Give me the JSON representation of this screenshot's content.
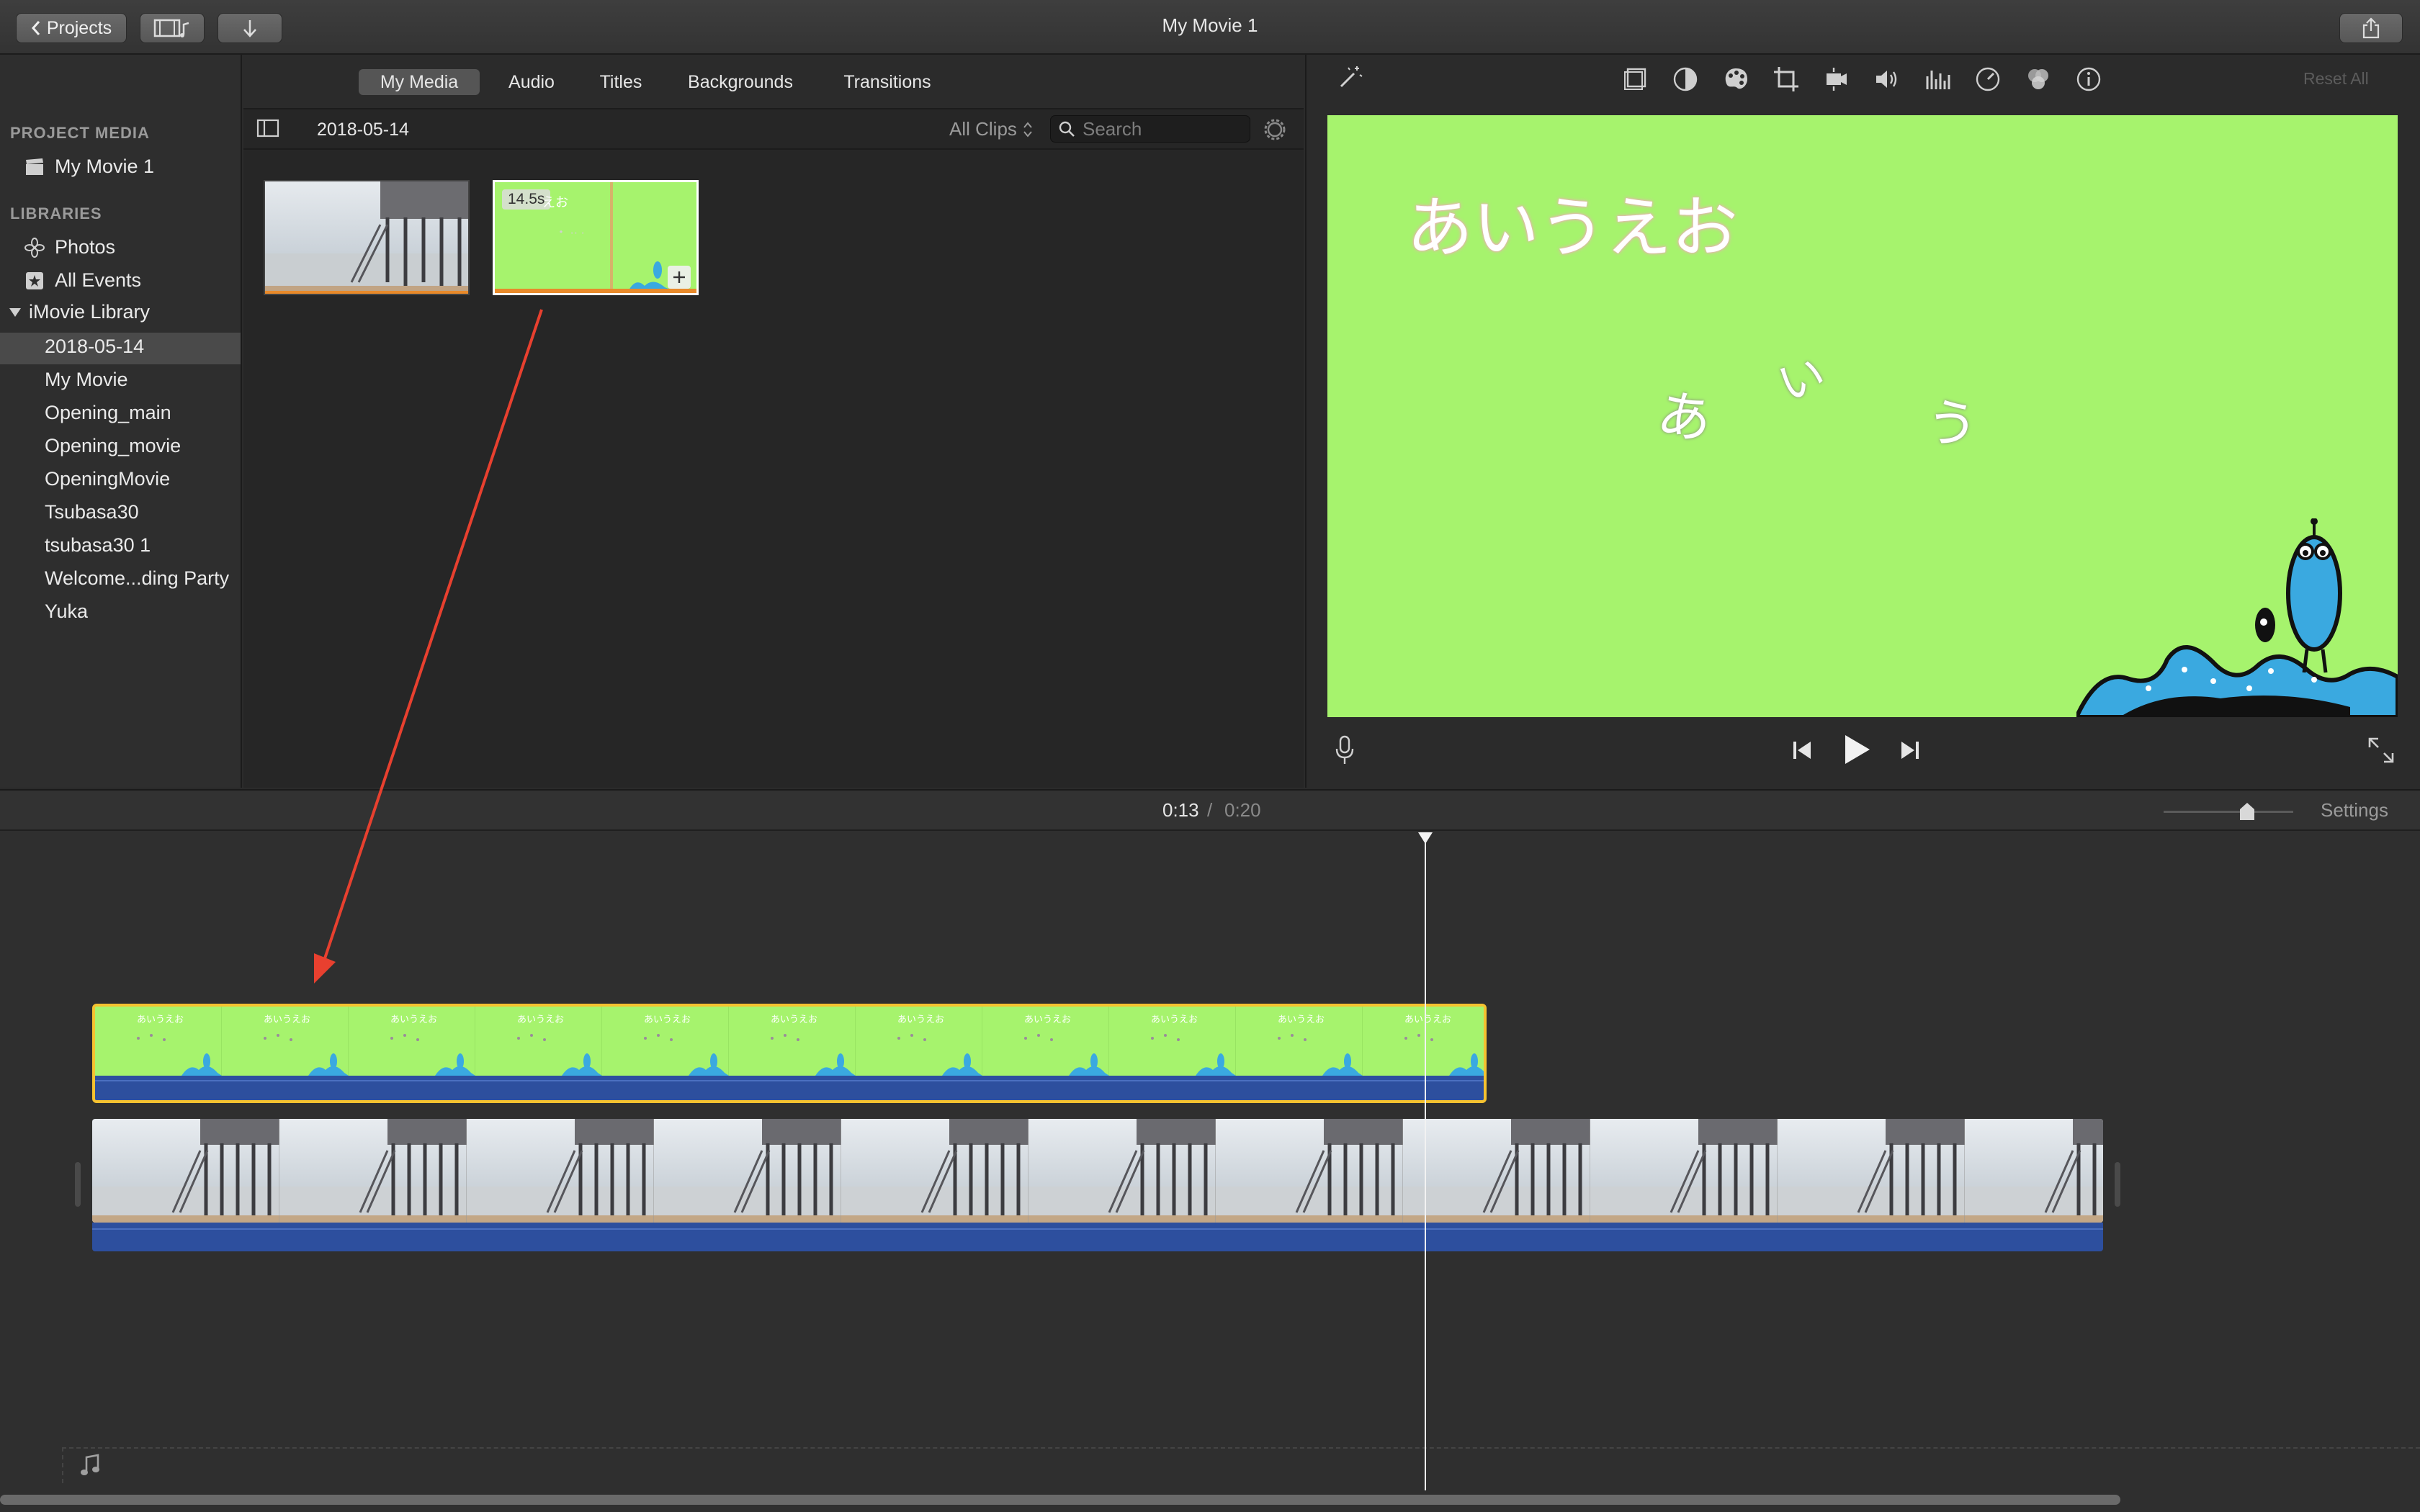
{
  "window": {
    "title": "My Movie 1"
  },
  "toolbar": {
    "projects_label": "Projects"
  },
  "sidebar": {
    "project_media_heading": "PROJECT MEDIA",
    "project_item": "My Movie 1",
    "libraries_heading": "LIBRARIES",
    "photos": "Photos",
    "all_events": "All Events",
    "library_name": "iMovie Library",
    "events": [
      "2018-05-14",
      "My Movie",
      "Opening_main",
      "Opening_movie",
      "OpeningMovie",
      "Tsubasa30",
      "tsubasa30 1",
      "Welcome...ding Party",
      "Yuka"
    ],
    "selected_event": "2018-05-14"
  },
  "media_tabs": [
    "My Media",
    "Audio",
    "Titles",
    "Backgrounds",
    "Transitions"
  ],
  "browser": {
    "event_title": "2018-05-14",
    "filter": "All Clips",
    "search_placeholder": "Search",
    "clip_duration_badge": "14.5s",
    "clip_overlay_text": "えお"
  },
  "viewer": {
    "reset_all": "Reset All",
    "title_text": "あいうえお",
    "chars": [
      "あ",
      "い",
      "う"
    ]
  },
  "timeline": {
    "current_time": "0:13",
    "separator": "/",
    "total_time": "0:20",
    "settings_label": "Settings",
    "thumb_title_text": "あいうえお"
  },
  "colors": {
    "accent_yellow": "#f5c230",
    "green_bg": "#a6f36d",
    "annotation_red": "#e8402f",
    "audio_blue": "#2d4f9e"
  }
}
